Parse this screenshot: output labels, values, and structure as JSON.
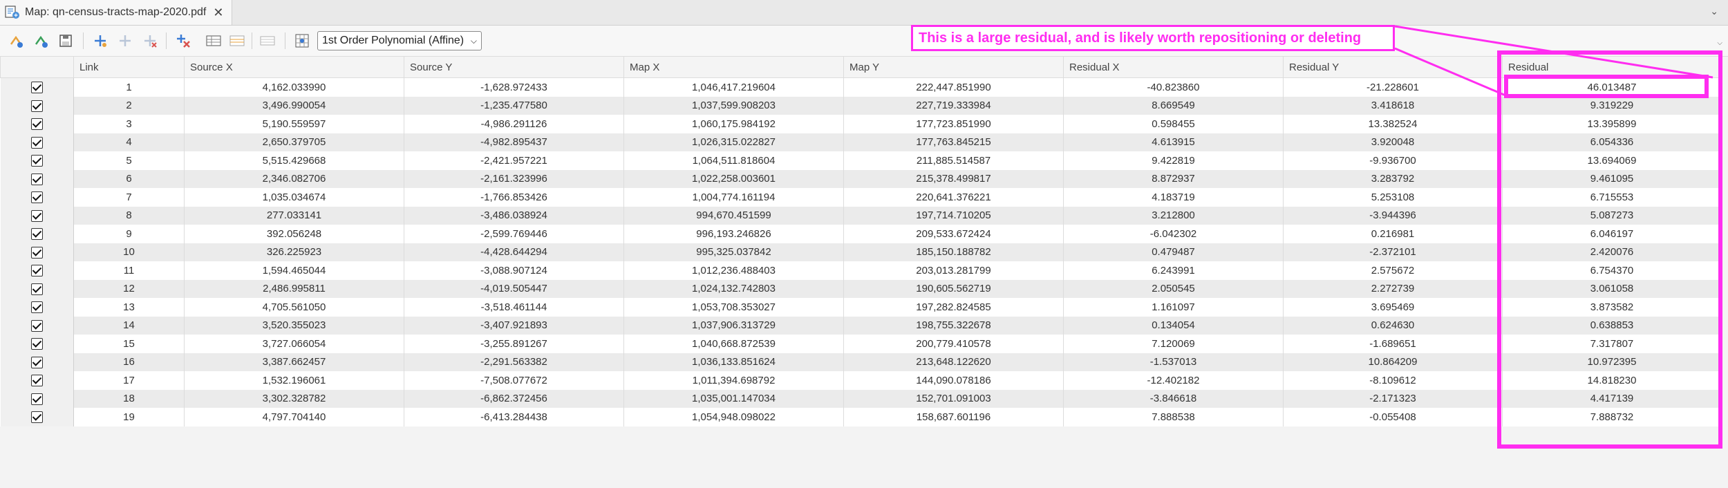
{
  "tab": {
    "title": "Map: qn-census-tracts-map-2020.pdf",
    "close_glyph": "✕",
    "icon": "map-icon"
  },
  "toolbar": {
    "transformation_selected": "1st Order Polynomial (Affine)",
    "icons": [
      "add-control-point-icon",
      "auto-adjust-icon",
      "save-icon",
      "new-link-icon",
      "edit-link-icon",
      "delete-link-icon",
      "delete-all-links-icon",
      "load-table-icon",
      "save-table-icon",
      "view-table-icon",
      "georeference-transform-icon"
    ]
  },
  "table": {
    "columns": [
      "",
      "Link",
      "Source X",
      "Source Y",
      "Map X",
      "Map Y",
      "Residual X",
      "Residual Y",
      "Residual"
    ],
    "rows": [
      [
        "1",
        "4,162.033990",
        "-1,628.972433",
        "1,046,417.219604",
        "222,447.851990",
        "-40.823860",
        "-21.228601",
        "46.013487"
      ],
      [
        "2",
        "3,496.990054",
        "-1,235.477580",
        "1,037,599.908203",
        "227,719.333984",
        "8.669549",
        "3.418618",
        "9.319229"
      ],
      [
        "3",
        "5,190.559597",
        "-4,986.291126",
        "1,060,175.984192",
        "177,723.851990",
        "0.598455",
        "13.382524",
        "13.395899"
      ],
      [
        "4",
        "2,650.379705",
        "-4,982.895437",
        "1,026,315.022827",
        "177,763.845215",
        "4.613915",
        "3.920048",
        "6.054336"
      ],
      [
        "5",
        "5,515.429668",
        "-2,421.957221",
        "1,064,511.818604",
        "211,885.514587",
        "9.422819",
        "-9.936700",
        "13.694069"
      ],
      [
        "6",
        "2,346.082706",
        "-2,161.323996",
        "1,022,258.003601",
        "215,378.499817",
        "8.872937",
        "3.283792",
        "9.461095"
      ],
      [
        "7",
        "1,035.034674",
        "-1,766.853426",
        "1,004,774.161194",
        "220,641.376221",
        "4.183719",
        "5.253108",
        "6.715553"
      ],
      [
        "8",
        "277.033141",
        "-3,486.038924",
        "994,670.451599",
        "197,714.710205",
        "3.212800",
        "-3.944396",
        "5.087273"
      ],
      [
        "9",
        "392.056248",
        "-2,599.769446",
        "996,193.246826",
        "209,533.672424",
        "-6.042302",
        "0.216981",
        "6.046197"
      ],
      [
        "10",
        "326.225923",
        "-4,428.644294",
        "995,325.037842",
        "185,150.188782",
        "0.479487",
        "-2.372101",
        "2.420076"
      ],
      [
        "11",
        "1,594.465044",
        "-3,088.907124",
        "1,012,236.488403",
        "203,013.281799",
        "6.243991",
        "2.575672",
        "6.754370"
      ],
      [
        "12",
        "2,486.995811",
        "-4,019.505447",
        "1,024,132.742803",
        "190,605.562719",
        "2.050545",
        "2.272739",
        "3.061058"
      ],
      [
        "13",
        "4,705.561050",
        "-3,518.461144",
        "1,053,708.353027",
        "197,282.824585",
        "1.161097",
        "3.695469",
        "3.873582"
      ],
      [
        "14",
        "3,520.355023",
        "-3,407.921893",
        "1,037,906.313729",
        "198,755.322678",
        "0.134054",
        "0.624630",
        "0.638853"
      ],
      [
        "15",
        "3,727.066054",
        "-3,255.891267",
        "1,040,668.872539",
        "200,779.410578",
        "7.120069",
        "-1.689651",
        "7.317807"
      ],
      [
        "16",
        "3,387.662457",
        "-2,291.563382",
        "1,036,133.851624",
        "213,648.122620",
        "-1.537013",
        "10.864209",
        "10.972395"
      ],
      [
        "17",
        "1,532.196061",
        "-7,508.077672",
        "1,011,394.698792",
        "144,090.078186",
        "-12.402182",
        "-8.109612",
        "14.818230"
      ],
      [
        "18",
        "3,302.328782",
        "-6,862.372456",
        "1,035,001.147034",
        "152,701.091003",
        "-3.846618",
        "-2.171323",
        "4.417139"
      ],
      [
        "19",
        "4,797.704140",
        "-6,413.284438",
        "1,054,948.098022",
        "158,687.601196",
        "7.888538",
        "-0.055408",
        "7.888732"
      ]
    ]
  },
  "annotation": {
    "text": "This is a large residual, and is likely worth repositioning or deleting",
    "color": "#ff2df0"
  }
}
